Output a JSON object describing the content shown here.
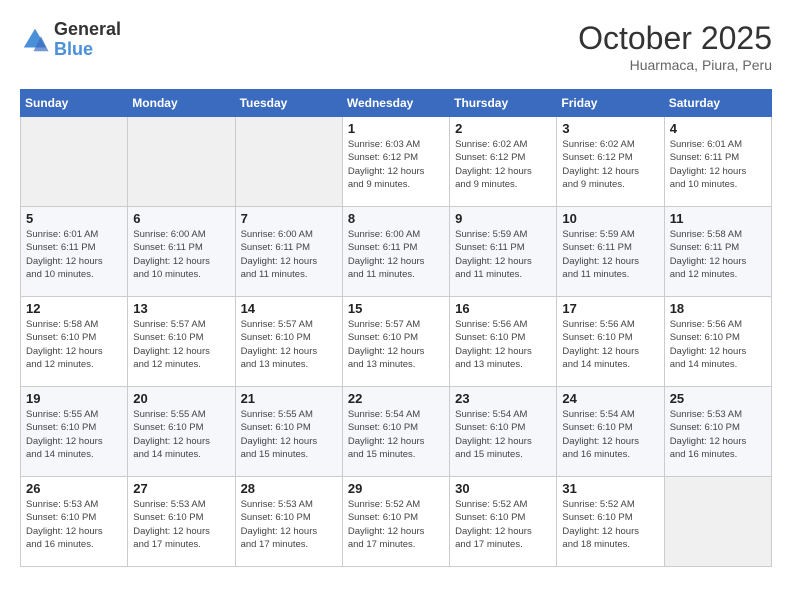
{
  "header": {
    "logo_general": "General",
    "logo_blue": "Blue",
    "month": "October 2025",
    "location": "Huarmaca, Piura, Peru"
  },
  "weekdays": [
    "Sunday",
    "Monday",
    "Tuesday",
    "Wednesday",
    "Thursday",
    "Friday",
    "Saturday"
  ],
  "weeks": [
    [
      {
        "day": "",
        "info": ""
      },
      {
        "day": "",
        "info": ""
      },
      {
        "day": "",
        "info": ""
      },
      {
        "day": "1",
        "info": "Sunrise: 6:03 AM\nSunset: 6:12 PM\nDaylight: 12 hours\nand 9 minutes."
      },
      {
        "day": "2",
        "info": "Sunrise: 6:02 AM\nSunset: 6:12 PM\nDaylight: 12 hours\nand 9 minutes."
      },
      {
        "day": "3",
        "info": "Sunrise: 6:02 AM\nSunset: 6:12 PM\nDaylight: 12 hours\nand 9 minutes."
      },
      {
        "day": "4",
        "info": "Sunrise: 6:01 AM\nSunset: 6:11 PM\nDaylight: 12 hours\nand 10 minutes."
      }
    ],
    [
      {
        "day": "5",
        "info": "Sunrise: 6:01 AM\nSunset: 6:11 PM\nDaylight: 12 hours\nand 10 minutes."
      },
      {
        "day": "6",
        "info": "Sunrise: 6:00 AM\nSunset: 6:11 PM\nDaylight: 12 hours\nand 10 minutes."
      },
      {
        "day": "7",
        "info": "Sunrise: 6:00 AM\nSunset: 6:11 PM\nDaylight: 12 hours\nand 11 minutes."
      },
      {
        "day": "8",
        "info": "Sunrise: 6:00 AM\nSunset: 6:11 PM\nDaylight: 12 hours\nand 11 minutes."
      },
      {
        "day": "9",
        "info": "Sunrise: 5:59 AM\nSunset: 6:11 PM\nDaylight: 12 hours\nand 11 minutes."
      },
      {
        "day": "10",
        "info": "Sunrise: 5:59 AM\nSunset: 6:11 PM\nDaylight: 12 hours\nand 11 minutes."
      },
      {
        "day": "11",
        "info": "Sunrise: 5:58 AM\nSunset: 6:11 PM\nDaylight: 12 hours\nand 12 minutes."
      }
    ],
    [
      {
        "day": "12",
        "info": "Sunrise: 5:58 AM\nSunset: 6:10 PM\nDaylight: 12 hours\nand 12 minutes."
      },
      {
        "day": "13",
        "info": "Sunrise: 5:57 AM\nSunset: 6:10 PM\nDaylight: 12 hours\nand 12 minutes."
      },
      {
        "day": "14",
        "info": "Sunrise: 5:57 AM\nSunset: 6:10 PM\nDaylight: 12 hours\nand 13 minutes."
      },
      {
        "day": "15",
        "info": "Sunrise: 5:57 AM\nSunset: 6:10 PM\nDaylight: 12 hours\nand 13 minutes."
      },
      {
        "day": "16",
        "info": "Sunrise: 5:56 AM\nSunset: 6:10 PM\nDaylight: 12 hours\nand 13 minutes."
      },
      {
        "day": "17",
        "info": "Sunrise: 5:56 AM\nSunset: 6:10 PM\nDaylight: 12 hours\nand 14 minutes."
      },
      {
        "day": "18",
        "info": "Sunrise: 5:56 AM\nSunset: 6:10 PM\nDaylight: 12 hours\nand 14 minutes."
      }
    ],
    [
      {
        "day": "19",
        "info": "Sunrise: 5:55 AM\nSunset: 6:10 PM\nDaylight: 12 hours\nand 14 minutes."
      },
      {
        "day": "20",
        "info": "Sunrise: 5:55 AM\nSunset: 6:10 PM\nDaylight: 12 hours\nand 14 minutes."
      },
      {
        "day": "21",
        "info": "Sunrise: 5:55 AM\nSunset: 6:10 PM\nDaylight: 12 hours\nand 15 minutes."
      },
      {
        "day": "22",
        "info": "Sunrise: 5:54 AM\nSunset: 6:10 PM\nDaylight: 12 hours\nand 15 minutes."
      },
      {
        "day": "23",
        "info": "Sunrise: 5:54 AM\nSunset: 6:10 PM\nDaylight: 12 hours\nand 15 minutes."
      },
      {
        "day": "24",
        "info": "Sunrise: 5:54 AM\nSunset: 6:10 PM\nDaylight: 12 hours\nand 16 minutes."
      },
      {
        "day": "25",
        "info": "Sunrise: 5:53 AM\nSunset: 6:10 PM\nDaylight: 12 hours\nand 16 minutes."
      }
    ],
    [
      {
        "day": "26",
        "info": "Sunrise: 5:53 AM\nSunset: 6:10 PM\nDaylight: 12 hours\nand 16 minutes."
      },
      {
        "day": "27",
        "info": "Sunrise: 5:53 AM\nSunset: 6:10 PM\nDaylight: 12 hours\nand 17 minutes."
      },
      {
        "day": "28",
        "info": "Sunrise: 5:53 AM\nSunset: 6:10 PM\nDaylight: 12 hours\nand 17 minutes."
      },
      {
        "day": "29",
        "info": "Sunrise: 5:52 AM\nSunset: 6:10 PM\nDaylight: 12 hours\nand 17 minutes."
      },
      {
        "day": "30",
        "info": "Sunrise: 5:52 AM\nSunset: 6:10 PM\nDaylight: 12 hours\nand 17 minutes."
      },
      {
        "day": "31",
        "info": "Sunrise: 5:52 AM\nSunset: 6:10 PM\nDaylight: 12 hours\nand 18 minutes."
      },
      {
        "day": "",
        "info": ""
      }
    ]
  ]
}
